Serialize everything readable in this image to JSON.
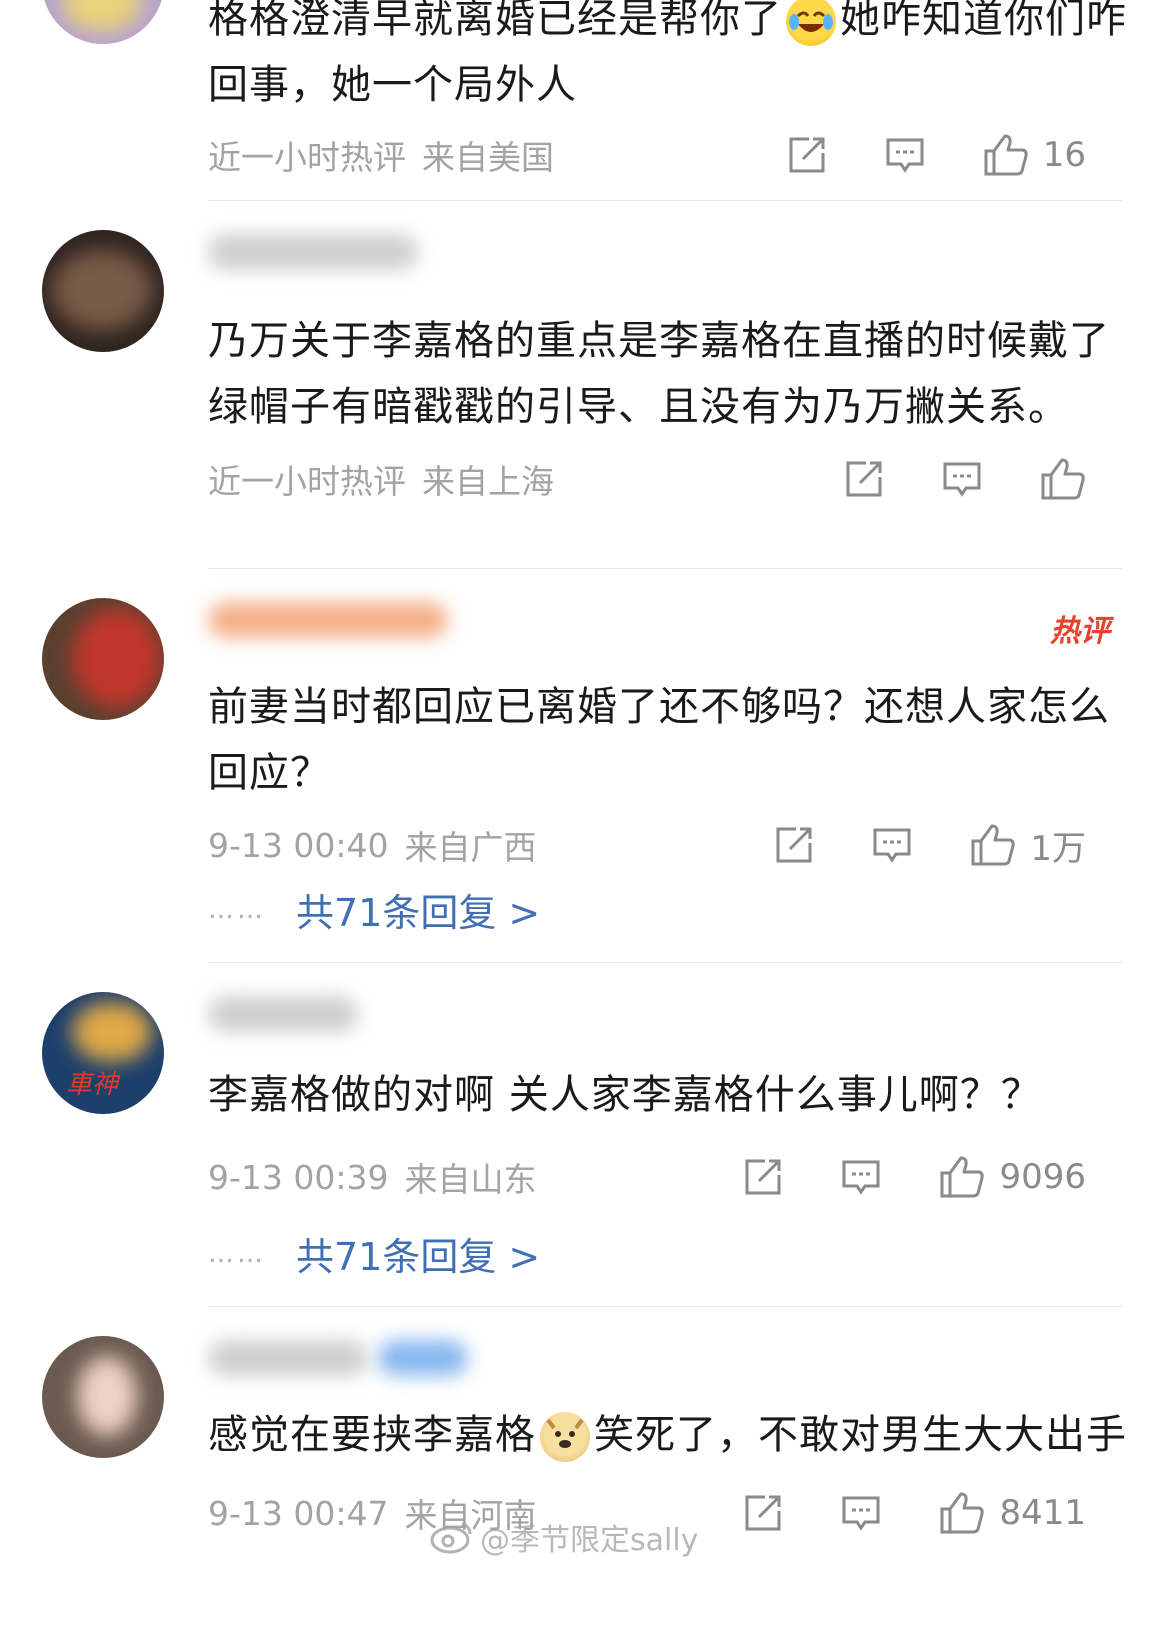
{
  "comments": [
    {
      "text_a": "格格澄清早就离婚已经是帮你了",
      "emoji": "laugh-cry-emoji",
      "text_b": "她咋知道你们咋回事，她一个局外人",
      "time": "近一小时热评",
      "location": "来自美国",
      "likes": "16"
    },
    {
      "text": "乃万关于李嘉格的重点是李嘉格在直播的时候戴了绿帽子有暗戳戳的引导、且没有为乃万撇关系。",
      "time": "近一小时热评",
      "location": "来自上海",
      "likes": ""
    },
    {
      "hot_badge": "热评",
      "text": "前妻当时都回应已离婚了还不够吗？还想人家怎么回应？",
      "time": "9-13 00:40",
      "location": "来自广西",
      "likes": "1万",
      "replies": "共71条回复 >"
    },
    {
      "text": "李嘉格做的对啊  关人家李嘉格什么事儿啊？？",
      "time": "9-13 00:39",
      "location": "来自山东",
      "likes": "9096",
      "replies": "共71条回复 >"
    },
    {
      "text_a": "感觉在要挟李嘉格",
      "emoji": "doge-emoji",
      "text_b": "笑死了，不敢对男生大大出手",
      "time": "9-13 00:47",
      "location": "来自河南",
      "likes": "8411"
    }
  ],
  "reply_dots": "……",
  "watermark": "@季节限定sally",
  "colors": {
    "link": "#3f6fb5",
    "meta": "#a3a3a3",
    "hot": "#e8412f"
  }
}
